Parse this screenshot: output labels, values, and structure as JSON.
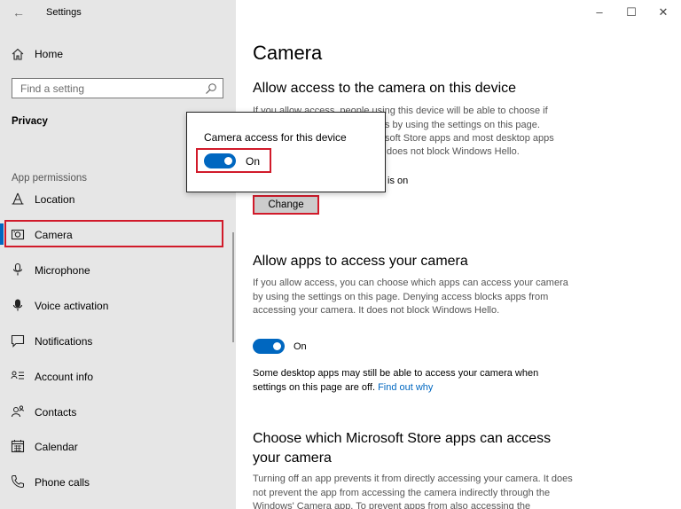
{
  "app": {
    "title": "Settings"
  },
  "sidebar": {
    "home_label": "Home",
    "search_placeholder": "Find a setting",
    "section_title": "Privacy",
    "group_label": "App permissions",
    "items": [
      {
        "label": "Location",
        "icon": "location-icon"
      },
      {
        "label": "Camera",
        "icon": "camera-icon",
        "selected": true
      },
      {
        "label": "Microphone",
        "icon": "microphone-icon"
      },
      {
        "label": "Voice activation",
        "icon": "voice-activation-icon"
      },
      {
        "label": "Notifications",
        "icon": "notifications-icon"
      },
      {
        "label": "Account info",
        "icon": "account-info-icon"
      },
      {
        "label": "Contacts",
        "icon": "contacts-icon"
      },
      {
        "label": "Calendar",
        "icon": "calendar-icon"
      },
      {
        "label": "Phone calls",
        "icon": "phone-icon"
      }
    ]
  },
  "main": {
    "title": "Camera",
    "section1": {
      "heading": "Allow access to the camera on this device",
      "line1": "If you allow access, people using this device will be able to choose if",
      "line2": "s by using the settings on this page.",
      "line3": "soft Store apps and most desktop apps",
      "line4": "does not block Windows Hello.",
      "status_fragment": "is on",
      "change_label": "Change"
    },
    "section2": {
      "heading": "Allow apps to access your camera",
      "para": "If you allow access, you can choose which apps can access your camera by using the settings on this page. Denying access blocks apps from accessing your camera. It does not block Windows Hello.",
      "toggle_label": "On",
      "note": "Some desktop apps may still be able to access your camera when settings on this page are off.",
      "link": "Find out why"
    },
    "section3": {
      "heading": "Choose which Microsoft Store apps can access your camera",
      "para": "Turning off an app prevents it from directly accessing your camera. It does not prevent the app from accessing the camera indirectly through the Windows' Camera app. To prevent apps from also accessing the"
    }
  },
  "popup": {
    "label": "Camera access for this device",
    "toggle_label": "On"
  },
  "colors": {
    "accent": "#0067c0",
    "highlight": "#d11a2a",
    "sidebar_bg": "#e6e6e6"
  }
}
